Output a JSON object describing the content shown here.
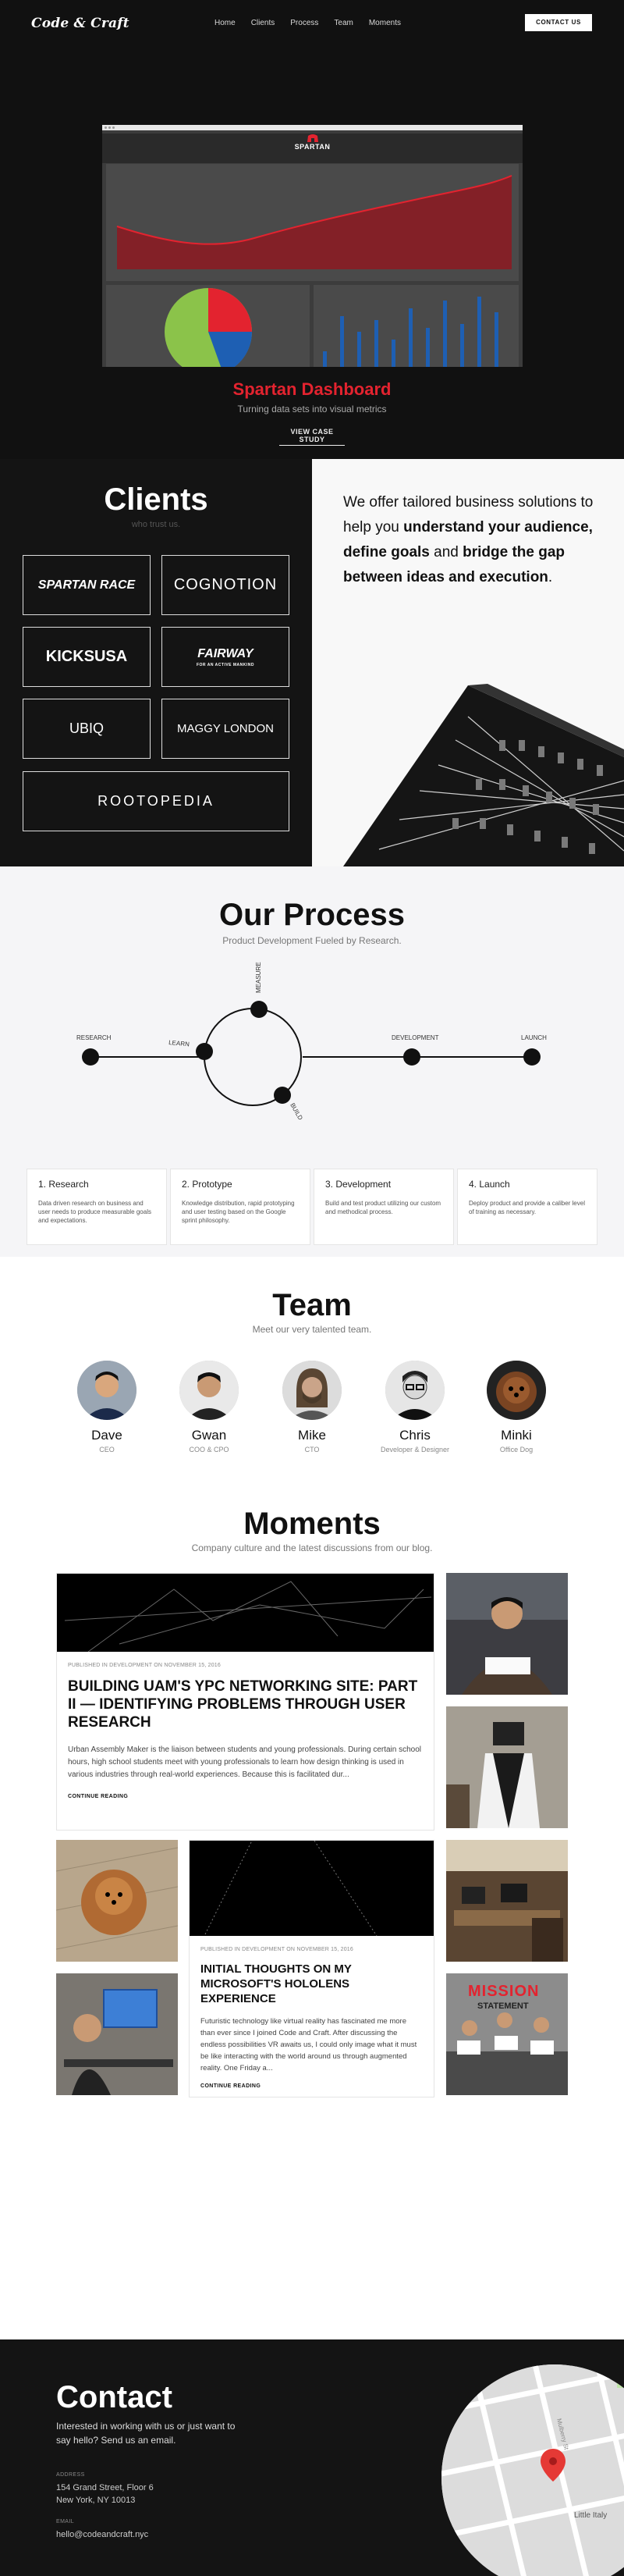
{
  "nav": {
    "logo": "Code & Craft",
    "items": [
      "Home",
      "Clients",
      "Process",
      "Team",
      "Moments"
    ],
    "contact_label": "CONTACT US"
  },
  "hero": {
    "mockup_brand": "SPARTAN",
    "title": "Spartan Dashboard",
    "subtitle": "Turning data sets into visual metrics",
    "link_label": "VIEW CASE STUDY",
    "accent_color": "#e3232f"
  },
  "clients": {
    "title": "Clients",
    "subtitle": "who trust us.",
    "logos": [
      "SPARTAN RACE",
      "COGNOTION",
      "KICKSUSA",
      "FAIRWAY",
      "UBIQ",
      "MAGGY LONDON",
      "ROOTOPEDIA"
    ],
    "fairway_tagline": "FOR AN ACTIVE MANKIND",
    "pitch": {
      "p1": "We offer tailored business solutions to help you ",
      "b1": "understand your audience, define goals",
      "p2": " and ",
      "b2": "bridge the gap between ideas and execution",
      "p3": "."
    }
  },
  "process": {
    "title": "Our Process",
    "subtitle": "Product Development Fueled by Research.",
    "diagram_labels": [
      "RESEARCH",
      "MEASURE",
      "LEARN",
      "BUILD",
      "DEVELOPMENT",
      "LAUNCH"
    ],
    "steps": [
      {
        "title": "1. Research",
        "text": "Data driven research on business and user needs to produce measurable goals and expectations."
      },
      {
        "title": "2. Prototype",
        "text": "Knowledge distribution, rapid prototyping and user testing based on the Google sprint philosophy."
      },
      {
        "title": "3. Development",
        "text": "Build and test product utilizing our custom and methodical process."
      },
      {
        "title": "4. Launch",
        "text": "Deploy product and provide a caliber level of training as necessary."
      }
    ]
  },
  "team": {
    "title": "Team",
    "subtitle": "Meet our very talented team.",
    "members": [
      {
        "name": "Dave",
        "role": "CEO"
      },
      {
        "name": "Gwan",
        "role": "COO & CPO"
      },
      {
        "name": "Mike",
        "role": "CTO"
      },
      {
        "name": "Chris",
        "role": "Developer & Designer"
      },
      {
        "name": "Minki",
        "role": "Office Dog"
      }
    ]
  },
  "moments": {
    "title": "Moments",
    "subtitle": "Company culture and the latest discussions from our blog.",
    "posts": [
      {
        "meta": "PUBLISHED IN DEVELOPMENT ON NOVEMBER 15, 2016",
        "title": "BUILDING UAM'S YPC NETWORKING SITE: PART II — IDENTIFYING PROBLEMS THROUGH USER RESEARCH",
        "excerpt": "Urban Assembly Maker is the liaison between students and young professionals. During certain school hours, high school students meet with young professionals to learn how design thinking is used in various industries through real-world experiences. Because this is facilitated dur...",
        "more": "CONTINUE READING"
      },
      {
        "meta": "PUBLISHED IN DEVELOPMENT ON NOVEMBER 15, 2016",
        "title": "INITIAL THOUGHTS ON MY MICROSOFT'S HOLOLENS EXPERIENCE",
        "excerpt": "Futuristic technology like virtual reality has fascinated me more than ever since I joined Code and Craft. After discussing the endless possibilities VR awaits us, I could only image what it must be like interacting with the world around us through augmented reality. One Friday a...",
        "more": "CONTINUE READING"
      }
    ],
    "photo_signs": [
      "MISSION",
      "STATEMENT"
    ]
  },
  "contact": {
    "title": "Contact",
    "intro": "Interested in working with us or just want to say hello? Send us an email.",
    "address_label": "ADDRESS",
    "address_line1": "154 Grand Street, Floor 6",
    "address_line2": "New York, NY 10013",
    "email_label": "EMAIL",
    "email": "hello@codeandcraft.nyc",
    "map_label": "Little Italy",
    "map_street": "Mulberry St",
    "map_pin_color": "#e53935"
  }
}
